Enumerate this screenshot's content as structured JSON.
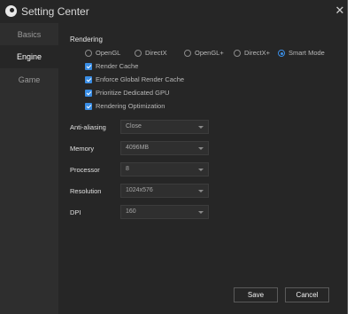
{
  "window": {
    "title": "Setting Center",
    "close_glyph": "✕"
  },
  "sidebar": {
    "items": [
      {
        "label": "Basics"
      },
      {
        "label": "Engine"
      },
      {
        "label": "Game"
      }
    ]
  },
  "rendering": {
    "title": "Rendering",
    "modes": [
      {
        "label": "OpenGL"
      },
      {
        "label": "DirectX"
      },
      {
        "label": "OpenGL+"
      },
      {
        "label": "DirectX+"
      },
      {
        "label": "Smart Mode"
      }
    ],
    "selected_mode": "Smart Mode",
    "options": [
      {
        "label": "Render Cache",
        "checked": true
      },
      {
        "label": "Enforce Global Render Cache",
        "checked": true
      },
      {
        "label": "Prioritize Dedicated GPU",
        "checked": true
      },
      {
        "label": "Rendering Optimization",
        "checked": true
      }
    ]
  },
  "settings": {
    "anti_aliasing": {
      "label": "Anti-aliasing",
      "value": "Close"
    },
    "memory": {
      "label": "Memory",
      "value": "4096MB"
    },
    "processor": {
      "label": "Processor",
      "value": "8"
    },
    "resolution": {
      "label": "Resolution",
      "value": "1024x576"
    },
    "dpi": {
      "label": "DPI",
      "value": "160"
    }
  },
  "buttons": {
    "save": "Save",
    "cancel": "Cancel"
  },
  "colors": {
    "accent": "#3a8ee6",
    "panel": "#262626"
  }
}
